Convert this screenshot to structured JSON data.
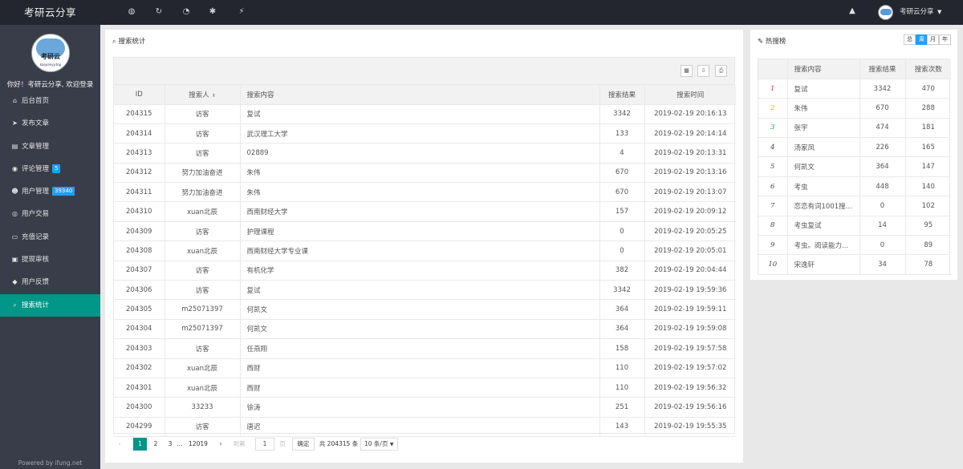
{
  "topbar": {
    "brand": "考研云分享",
    "tools": [
      {
        "icon": "globe-icon",
        "glyph": "◍"
      },
      {
        "icon": "refresh-icon",
        "glyph": "↻"
      },
      {
        "icon": "dashboard-icon",
        "glyph": "◔"
      },
      {
        "icon": "gear-icon",
        "glyph": "✱"
      },
      {
        "icon": "plug-icon",
        "glyph": "⚡"
      }
    ],
    "warn_glyph": "▲",
    "username": "考研云分享",
    "caret": "▼"
  },
  "sidebar": {
    "logo_text": "考研云",
    "logo_sub": "kaoyanyy.top",
    "welcome": "你好！考研云分享, 欢迎登录",
    "items": [
      {
        "icon": "home-icon",
        "glyph": "⌂",
        "label": "后台首页",
        "badge": ""
      },
      {
        "icon": "send-icon",
        "glyph": "➤",
        "label": "发布文章",
        "badge": ""
      },
      {
        "icon": "book-icon",
        "glyph": "▤",
        "label": "文章管理",
        "badge": ""
      },
      {
        "icon": "comments-icon",
        "glyph": "◉",
        "label": "评论管理",
        "badge": "5"
      },
      {
        "icon": "users-icon",
        "glyph": "☻",
        "label": "用户管理",
        "badge": "39340"
      },
      {
        "icon": "eye-icon",
        "glyph": "◎",
        "label": "用户交易",
        "badge": ""
      },
      {
        "icon": "credit-card-icon",
        "glyph": "▭",
        "label": "充值记录",
        "badge": ""
      },
      {
        "icon": "cash-icon",
        "glyph": "▣",
        "label": "提现审核",
        "badge": ""
      },
      {
        "icon": "bullhorn-icon",
        "glyph": "◆",
        "label": "用户反馈",
        "badge": ""
      },
      {
        "icon": "search-icon",
        "glyph": "⌕",
        "label": "搜索统计",
        "badge": ""
      }
    ],
    "powered": "Powered by ifung.net"
  },
  "main": {
    "title": "搜索统计",
    "title_glyph": "⌕",
    "toolbar": [
      {
        "icon": "columns-icon",
        "glyph": "▦"
      },
      {
        "icon": "export-icon",
        "glyph": "⇩"
      },
      {
        "icon": "print-icon",
        "glyph": "⎙"
      }
    ],
    "columns": [
      "ID",
      "搜索人",
      "搜索内容",
      "搜索结果",
      "搜索时间"
    ],
    "sort_glyph": "⬍",
    "rows": [
      {
        "id": "204315",
        "user": "访客",
        "content": "复试",
        "result": "3342",
        "time": "2019-02-19 20:16:13"
      },
      {
        "id": "204314",
        "user": "访客",
        "content": "武汉理工大学",
        "result": "133",
        "time": "2019-02-19 20:14:14"
      },
      {
        "id": "204313",
        "user": "访客",
        "content": "02889",
        "result": "4",
        "time": "2019-02-19 20:13:31"
      },
      {
        "id": "204312",
        "user": "努力加油奋进",
        "content": "朱伟",
        "result": "670",
        "time": "2019-02-19 20:13:16"
      },
      {
        "id": "204311",
        "user": "努力加油奋进",
        "content": "朱伟",
        "result": "670",
        "time": "2019-02-19 20:13:07"
      },
      {
        "id": "204310",
        "user": "xuan北辰",
        "content": "西南财经大学",
        "result": "157",
        "time": "2019-02-19 20:09:12"
      },
      {
        "id": "204309",
        "user": "访客",
        "content": "护理课程",
        "result": "0",
        "time": "2019-02-19 20:05:25"
      },
      {
        "id": "204308",
        "user": "xuan北辰",
        "content": "西南财经大学专业课",
        "result": "0",
        "time": "2019-02-19 20:05:01"
      },
      {
        "id": "204307",
        "user": "访客",
        "content": "有机化学",
        "result": "382",
        "time": "2019-02-19 20:04:44"
      },
      {
        "id": "204306",
        "user": "访客",
        "content": "复试",
        "result": "3342",
        "time": "2019-02-19 19:59:36"
      },
      {
        "id": "204305",
        "user": "m25071397",
        "content": "何凯文",
        "result": "364",
        "time": "2019-02-19 19:59:11"
      },
      {
        "id": "204304",
        "user": "m25071397",
        "content": "何凯文",
        "result": "364",
        "time": "2019-02-19 19:59:08"
      },
      {
        "id": "204303",
        "user": "访客",
        "content": "任燕翔",
        "result": "158",
        "time": "2019-02-19 19:57:58"
      },
      {
        "id": "204302",
        "user": "xuan北辰",
        "content": "西财",
        "result": "110",
        "time": "2019-02-19 19:57:02"
      },
      {
        "id": "204301",
        "user": "xuan北辰",
        "content": "西财",
        "result": "110",
        "time": "2019-02-19 19:56:32"
      },
      {
        "id": "204300",
        "user": "33233",
        "content": "徐涛",
        "result": "251",
        "time": "2019-02-19 19:56:16"
      },
      {
        "id": "204299",
        "user": "访客",
        "content": "唐迟",
        "result": "143",
        "time": "2019-02-19 19:55:35"
      }
    ],
    "pager": {
      "prev": "‹",
      "pages": [
        "1",
        "2",
        "3"
      ],
      "ellipsis": "…",
      "last": "12019",
      "next": "›",
      "goto_label": "到第",
      "goto_value": "1",
      "page_unit": "页",
      "confirm": "确定",
      "total": "共 204315 条",
      "per_page": "10 条/页",
      "per_caret": "▼"
    }
  },
  "hot": {
    "title": "热搜榜",
    "title_glyph": "✎",
    "tabs": [
      "总",
      "周",
      "月",
      "年"
    ],
    "active_tab": "周",
    "columns": [
      "",
      "搜索内容",
      "搜索结果",
      "搜索次数"
    ],
    "rows": [
      {
        "rank": "1",
        "content": "复试",
        "result": "3342",
        "count": "470"
      },
      {
        "rank": "2",
        "content": "朱伟",
        "result": "670",
        "count": "288"
      },
      {
        "rank": "3",
        "content": "张宇",
        "result": "474",
        "count": "181"
      },
      {
        "rank": "4",
        "content": "汤家凤",
        "result": "226",
        "count": "165"
      },
      {
        "rank": "5",
        "content": "何凯文",
        "result": "364",
        "count": "147"
      },
      {
        "rank": "6",
        "content": "考虫",
        "result": "448",
        "count": "140"
      },
      {
        "rank": "7",
        "content": "恋恋有词1001搜...",
        "result": "0",
        "count": "102"
      },
      {
        "rank": "8",
        "content": "考虫复试",
        "result": "14",
        "count": "95"
      },
      {
        "rank": "9",
        "content": "考虫。阅读能力...",
        "result": "0",
        "count": "89"
      },
      {
        "rank": "10",
        "content": "宋逸轩",
        "result": "34",
        "count": "78"
      }
    ],
    "rank_colors": [
      "#d9282f",
      "#f0ad00",
      "#2d9a3a",
      "#444444"
    ]
  },
  "colors": {
    "topbar": "#23262e",
    "sidebar": "#393d49",
    "active": "#009688",
    "badge": "#1e9fff"
  }
}
